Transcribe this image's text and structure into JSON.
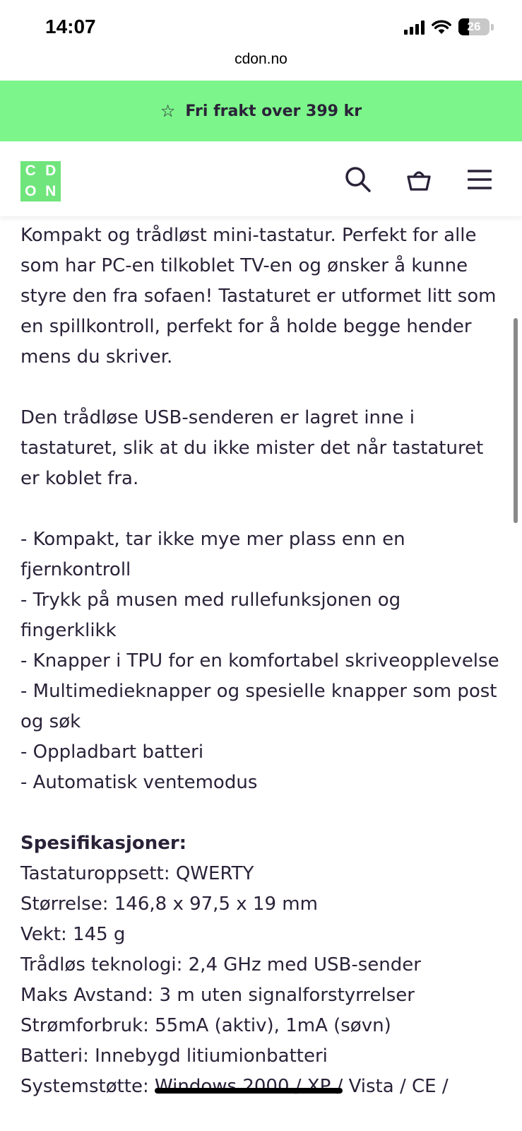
{
  "status_bar": {
    "time": "14:07",
    "battery": "26"
  },
  "url": "cdon.no",
  "promo": {
    "icon": "star-icon",
    "text": "Fri frakt over 399 kr"
  },
  "header": {
    "logo_letters": [
      "C",
      "D",
      "O",
      "N"
    ],
    "actions": [
      "search-icon",
      "basket-icon",
      "menu-icon"
    ]
  },
  "description": {
    "para1": "Kompakt og trådløst mini-tastatur. Perfekt for alle som har PC-en tilkoblet TV-en og ønsker å kunne styre den fra sofaen! Tastaturet er utformet litt som en spillkontroll, perfekt for å holde begge hender mens du skriver.",
    "para2": "Den trådløse USB-senderen er lagret inne i tastaturet, slik at du ikke mister det når tastaturet er koblet fra.",
    "features": [
      "- Kompakt, tar ikke mye mer plass enn en fjernkontroll",
      "- Trykk på musen med rullefunksjonen og fingerklikk",
      "- Knapper i TPU for en komfortabel skriveopplevelse",
      "- Multimedieknapper og spesielle knapper som post og søk",
      "- Oppladbart batteri",
      "- Automatisk ventemodus"
    ],
    "spec_heading": "Spesifikasjoner:",
    "specs": [
      "Tastaturoppsett: QWERTY",
      "Størrelse: 146,8 x 97,5 x 19 mm",
      "Vekt: 145 g",
      "Trådløs teknologi: 2,4 GHz med USB-sender",
      "Maks Avstand: 3 m uten signalforstyrrelser",
      "Strømforbruk: 55mA (aktiv), 1mA (søvn)",
      "Batteri: Innebygd litiumionbatteri"
    ],
    "system_label": "Systemstøtte: ",
    "system_struck": "Windows 2000 / XP /",
    "system_rest": " Vista / CE /"
  }
}
